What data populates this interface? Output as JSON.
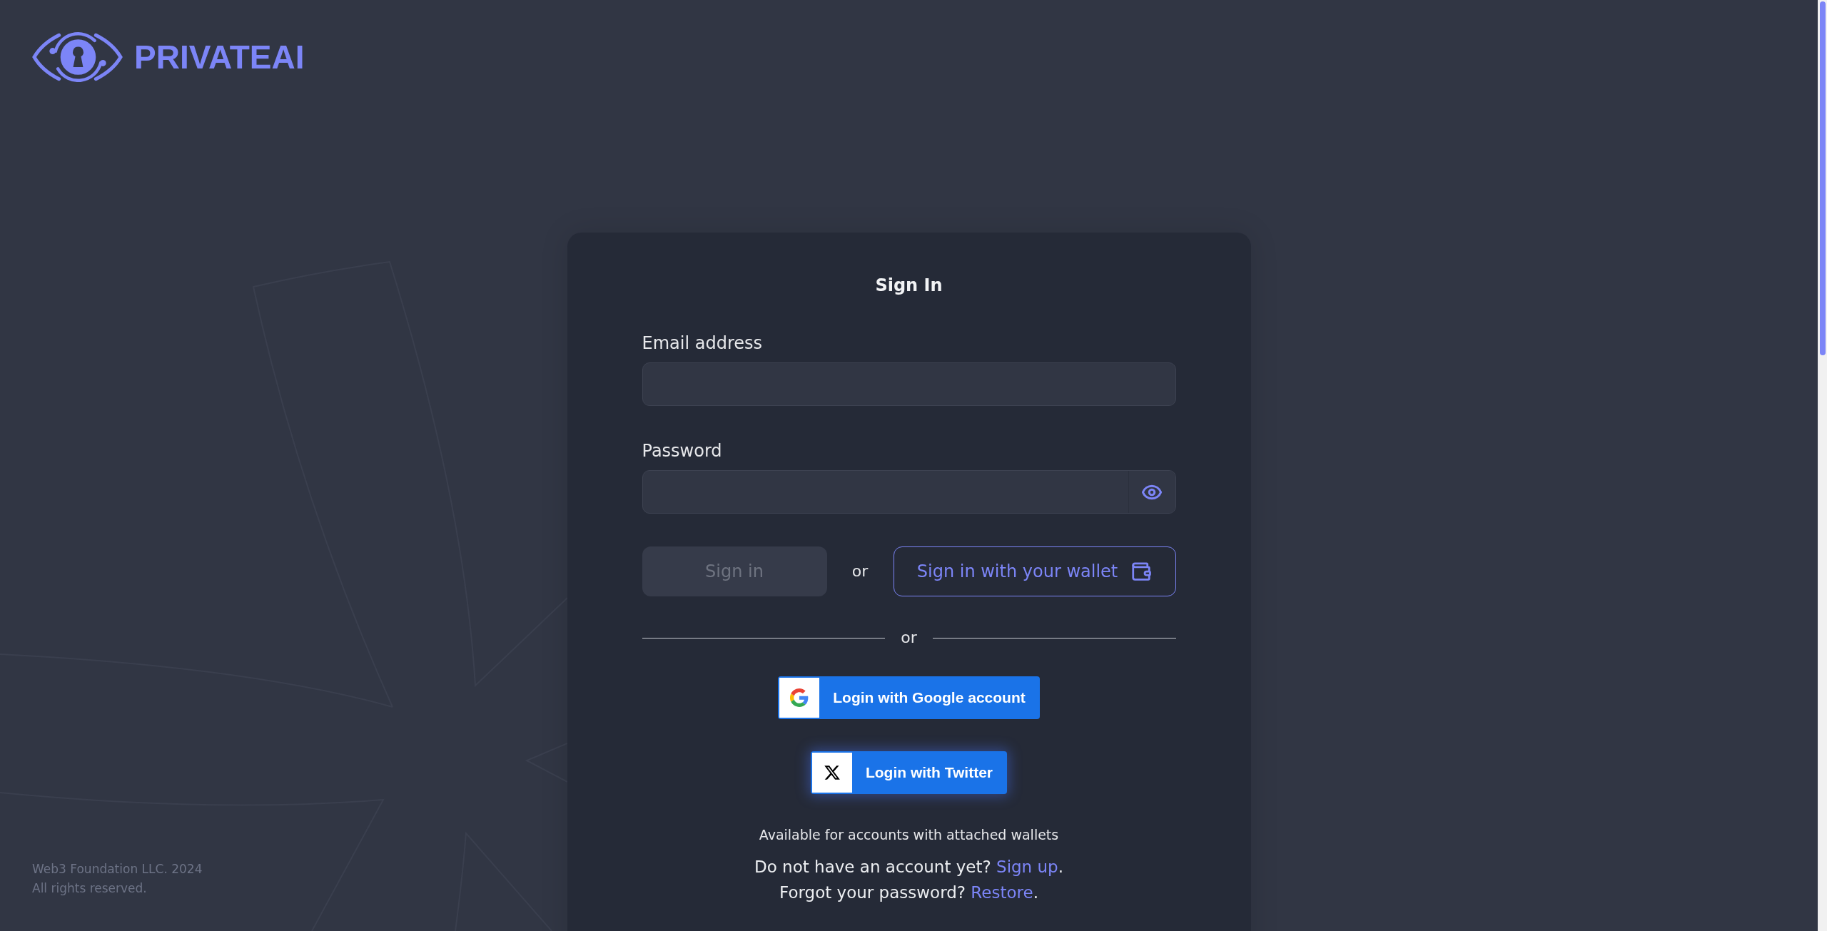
{
  "logo": {
    "text": "PRIVATEAI"
  },
  "sign_in": {
    "title": "Sign In",
    "fields": [
      {
        "label": "Email address",
        "kind": "email"
      },
      {
        "label": "Password",
        "kind": "password"
      }
    ],
    "actions": {
      "sign_in_button": {
        "label": "Sign in",
        "disabled": true
      },
      "separator": "or",
      "wallet_button": {
        "label": "Sign in with your wallet"
      }
    },
    "divider": {
      "text": "or"
    },
    "social_buttons": [
      {
        "kind": "google",
        "label": "Login with Google account",
        "focused": false
      },
      {
        "kind": "twitter",
        "label": "Login with Twitter",
        "focused": true
      }
    ],
    "note": "Available for accounts with attached wallets",
    "prompts": [
      {
        "text": "Do not have an account yet?",
        "link": "Sign up",
        "end": "."
      },
      {
        "text": "Forgot your password?",
        "link": "Restore",
        "end": "."
      }
    ]
  },
  "footer": {
    "lines": [
      "Web3 Foundation LLC. 2024",
      "All rights reserved."
    ]
  }
}
